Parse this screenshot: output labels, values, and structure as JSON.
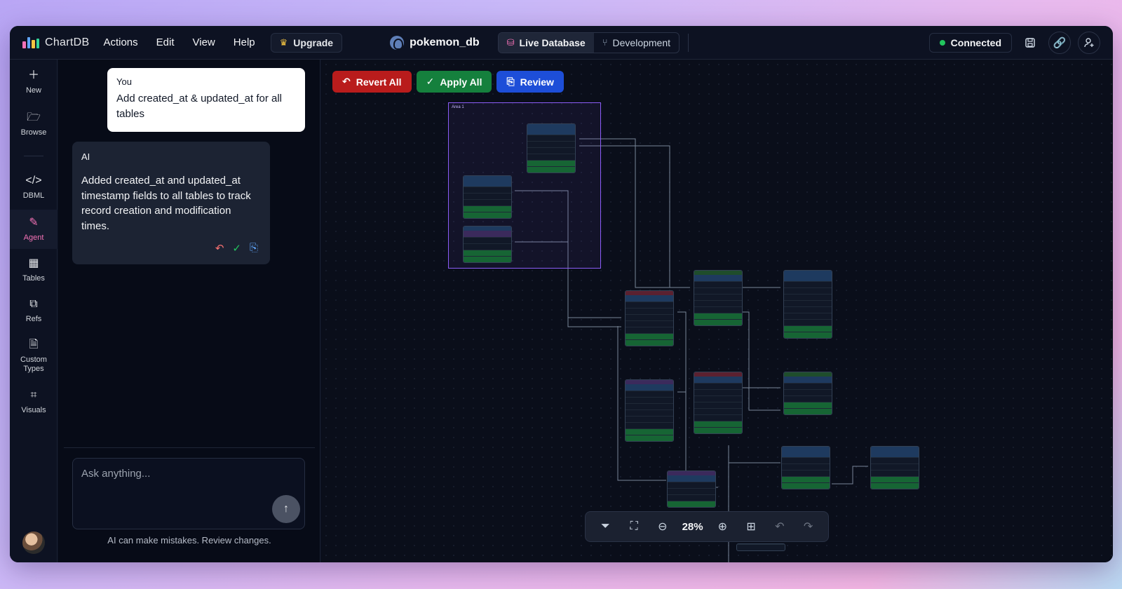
{
  "app": {
    "name": "ChartDB",
    "menu": [
      "Actions",
      "Edit",
      "View",
      "Help"
    ],
    "upgrade_label": "Upgrade",
    "database_name": "pokemon_db",
    "env_tabs": [
      "Live Database",
      "Development"
    ],
    "status": "Connected"
  },
  "rail": {
    "items": [
      {
        "label": "New",
        "icon": "plus-icon"
      },
      {
        "label": "Browse",
        "icon": "folder-icon"
      },
      {
        "label": "DBML",
        "icon": "code-icon"
      },
      {
        "label": "Agent",
        "icon": "magic-wand-icon"
      },
      {
        "label": "Tables",
        "icon": "table-icon"
      },
      {
        "label": "Refs",
        "icon": "relations-icon"
      },
      {
        "label": "Custom Types",
        "icon": "file-type-icon"
      },
      {
        "label": "Visuals",
        "icon": "scan-icon"
      }
    ]
  },
  "chat": {
    "user_label": "You",
    "user_message": "Add created_at & updated_at for all tables",
    "ai_label": "AI",
    "ai_message": "Added created_at and updated_at timestamp fields to all tables to track record creation and modification times.",
    "input_placeholder": "Ask anything...",
    "disclaimer": "AI can make mistakes. Review changes."
  },
  "canvas": {
    "revert_label": "Revert All",
    "apply_label": "Apply All",
    "review_label": "Review",
    "area_label": "Area 1",
    "zoom": "28%",
    "accent_colors": {
      "revert": "#b91c1c",
      "apply": "#15803d",
      "review": "#1d4ed8",
      "agent": "#f472b6"
    }
  }
}
